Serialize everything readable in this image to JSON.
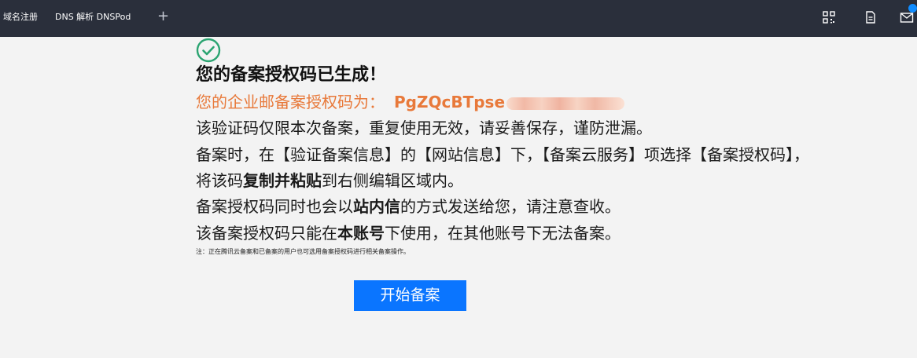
{
  "topbar": {
    "tab_domain": "域名注册",
    "tab_dns": "DNS 解析 DNSPod",
    "add_symbol": "+",
    "icons": [
      "qrcode-icon",
      "document-icon",
      "mail-icon"
    ]
  },
  "main": {
    "title": "您的备案授权码已生成！",
    "code_label": "您的企业邮备案授权码为：",
    "code_value": "PgZQcBTpse",
    "line1": "该验证码仅限本次备案，重复使用无效，请妥善保存，谨防泄漏。",
    "line2": "备案时，在【验证备案信息】的【网站信息】下，【备案云服务】项选择【备案授权码】，",
    "line3_a": "将该码",
    "line3_b": "复制并粘贴",
    "line3_c": "到右侧编辑区域内。",
    "line4_a": "备案授权码同时也会以",
    "line4_b": "站内信",
    "line4_c": "的方式发送给您，请注意查收。",
    "line5_a": "该备案授权码只能在",
    "line5_b": "本账号",
    "line5_c": "下使用，在其他账号下无法备案。",
    "note": "注：正在腾讯云备案和已备案的用户也可选用备案授权码进行相关备案操作。",
    "start_button": "开始备案"
  },
  "colors": {
    "topbar_bg": "#2a2f3b",
    "accent_orange": "#e8793a",
    "button_blue": "#0a75ff",
    "success_green": "#2ba471"
  }
}
